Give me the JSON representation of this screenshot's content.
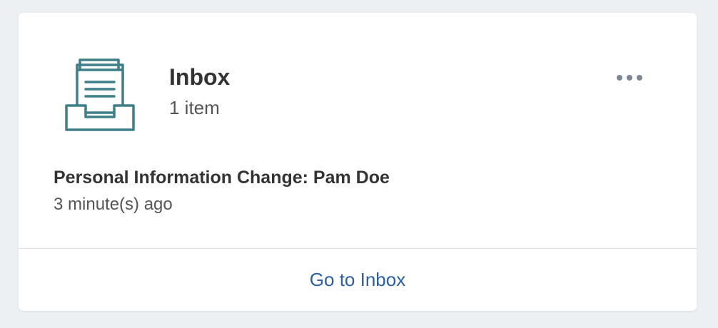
{
  "widget": {
    "title": "Inbox",
    "count_text": "1 item",
    "icon": "inbox-tray-icon",
    "more_icon": "more-horizontal-icon"
  },
  "items": [
    {
      "title": "Personal Information Change: Pam Doe",
      "time": "3 minute(s) ago"
    }
  ],
  "footer": {
    "link_label": "Go to Inbox"
  },
  "colors": {
    "background": "#edf0f3",
    "card": "#ffffff",
    "icon": "#3f7f87",
    "link": "#2a5ea8",
    "more_dots": "#7d8791"
  }
}
